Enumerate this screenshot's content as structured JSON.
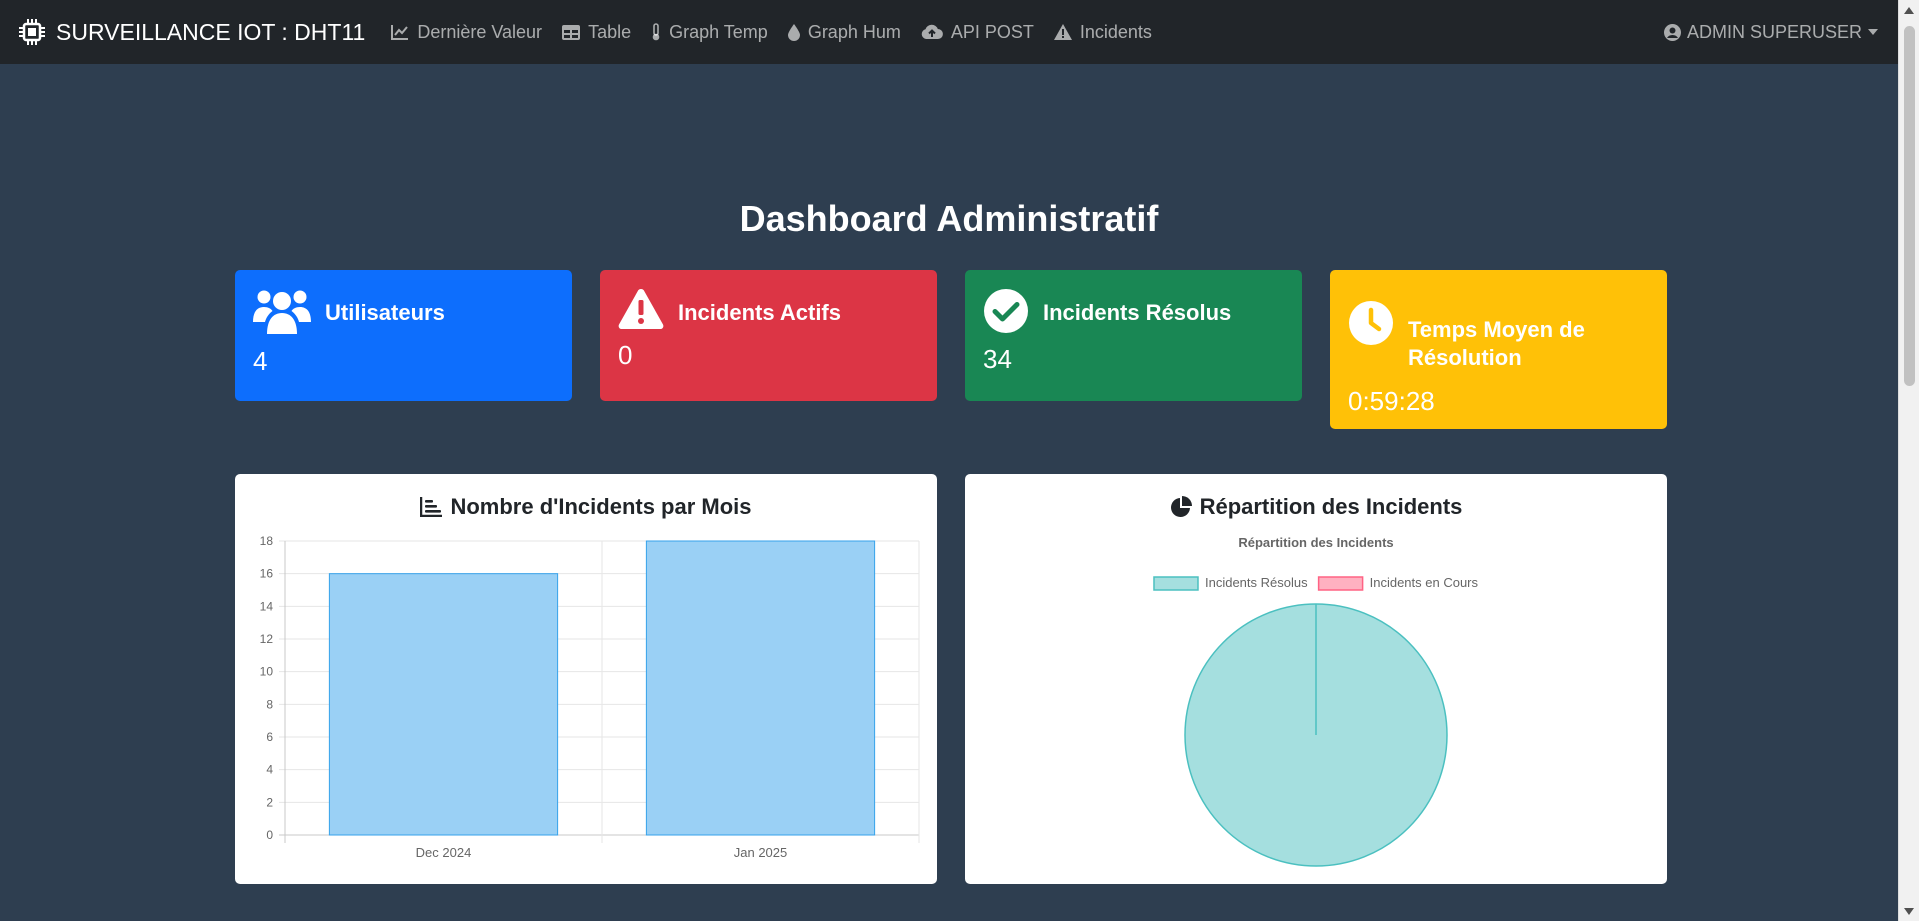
{
  "navbar": {
    "brand": "SURVEILLANCE IOT : DHT11",
    "links": [
      {
        "label": "Dernière Valeur",
        "icon": "chart-line-icon"
      },
      {
        "label": "Table",
        "icon": "table-icon"
      },
      {
        "label": "Graph Temp",
        "icon": "thermometer-icon"
      },
      {
        "label": "Graph Hum",
        "icon": "droplet-icon"
      },
      {
        "label": "API POST",
        "icon": "cloud-upload-icon"
      },
      {
        "label": "Incidents",
        "icon": "warning-icon"
      }
    ],
    "user": "ADMIN SUPERUSER"
  },
  "page": {
    "title": "Dashboard Administratif"
  },
  "stats": [
    {
      "title": "Utilisateurs",
      "value": "4",
      "icon": "users-icon",
      "color": "#0d6efd"
    },
    {
      "title": "Incidents Actifs",
      "value": "0",
      "icon": "warning-icon",
      "color": "#dc3545"
    },
    {
      "title": "Incidents Résolus",
      "value": "34",
      "icon": "check-circle-icon",
      "color": "#198754"
    },
    {
      "title": "Temps Moyen de Résolution",
      "value": "0:59:28",
      "icon": "clock-icon",
      "color": "#ffc107"
    }
  ],
  "panels": {
    "bar_title": "Nombre d'Incidents par Mois",
    "pie_title": "Répartition des Incidents"
  },
  "chart_data": [
    {
      "type": "bar",
      "title": "",
      "categories": [
        "Dec 2024",
        "Jan 2025"
      ],
      "values": [
        16,
        18
      ],
      "ylim": [
        0,
        18
      ],
      "yticks": [
        0,
        2,
        4,
        6,
        8,
        10,
        12,
        14,
        16,
        18
      ],
      "grid": true,
      "color": "#9ad0f5",
      "border_color": "#36a2eb"
    },
    {
      "type": "pie",
      "title": "Répartition des Incidents",
      "labels": [
        "Incidents Résolus",
        "Incidents en Cours"
      ],
      "values": [
        34,
        0
      ],
      "colors": [
        "#a5dfdf",
        "#ffb1c1"
      ],
      "border_colors": [
        "#4bc0c0",
        "#ff6384"
      ],
      "legend_position": "top"
    }
  ]
}
